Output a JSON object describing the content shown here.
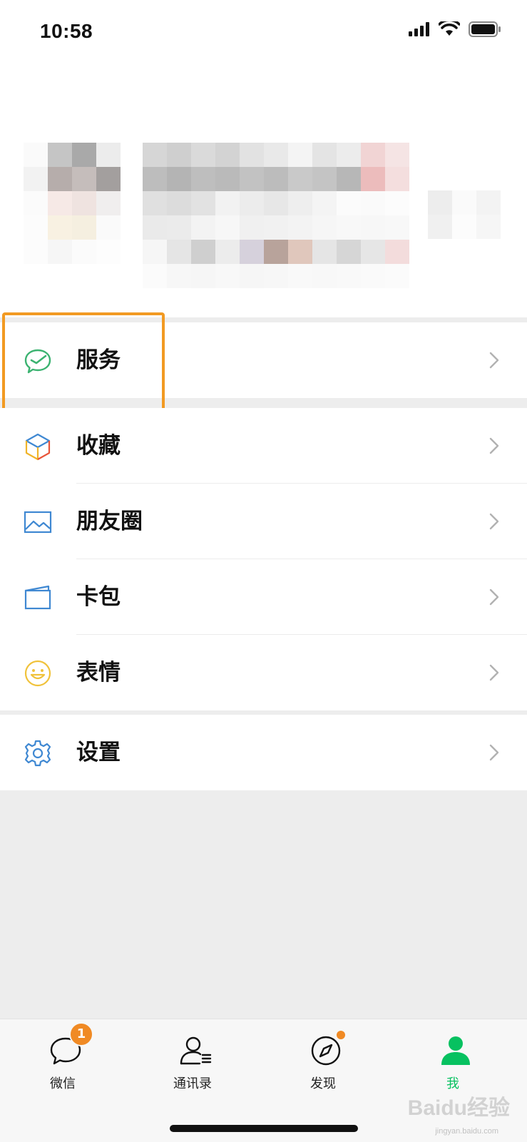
{
  "status_bar": {
    "time": "10:58"
  },
  "menu": {
    "group1": [
      {
        "label": "服务",
        "icon": "wechat-pay-icon",
        "color": "#3cb371"
      }
    ],
    "group2": [
      {
        "label": "收藏",
        "icon": "favorites-cube-icon"
      },
      {
        "label": "朋友圈",
        "icon": "moments-image-icon"
      },
      {
        "label": "卡包",
        "icon": "card-wallet-icon"
      },
      {
        "label": "表情",
        "icon": "emoji-face-icon"
      }
    ],
    "group3": [
      {
        "label": "设置",
        "icon": "settings-gear-icon"
      }
    ]
  },
  "tabbar": {
    "tabs": [
      {
        "label": "微信",
        "icon": "chat-bubble-icon",
        "badge": "1",
        "active": false
      },
      {
        "label": "通讯录",
        "icon": "contacts-icon",
        "active": false
      },
      {
        "label": "发现",
        "icon": "compass-icon",
        "dot": true,
        "active": false
      },
      {
        "label": "我",
        "icon": "me-person-icon",
        "active": true
      }
    ]
  },
  "colors": {
    "accent_green": "#07c160",
    "highlight_orange": "#f29a22",
    "badge_orange": "#f08a24"
  },
  "watermark": {
    "brand": "Baidu经验",
    "url": "jingyan.baidu.com"
  }
}
